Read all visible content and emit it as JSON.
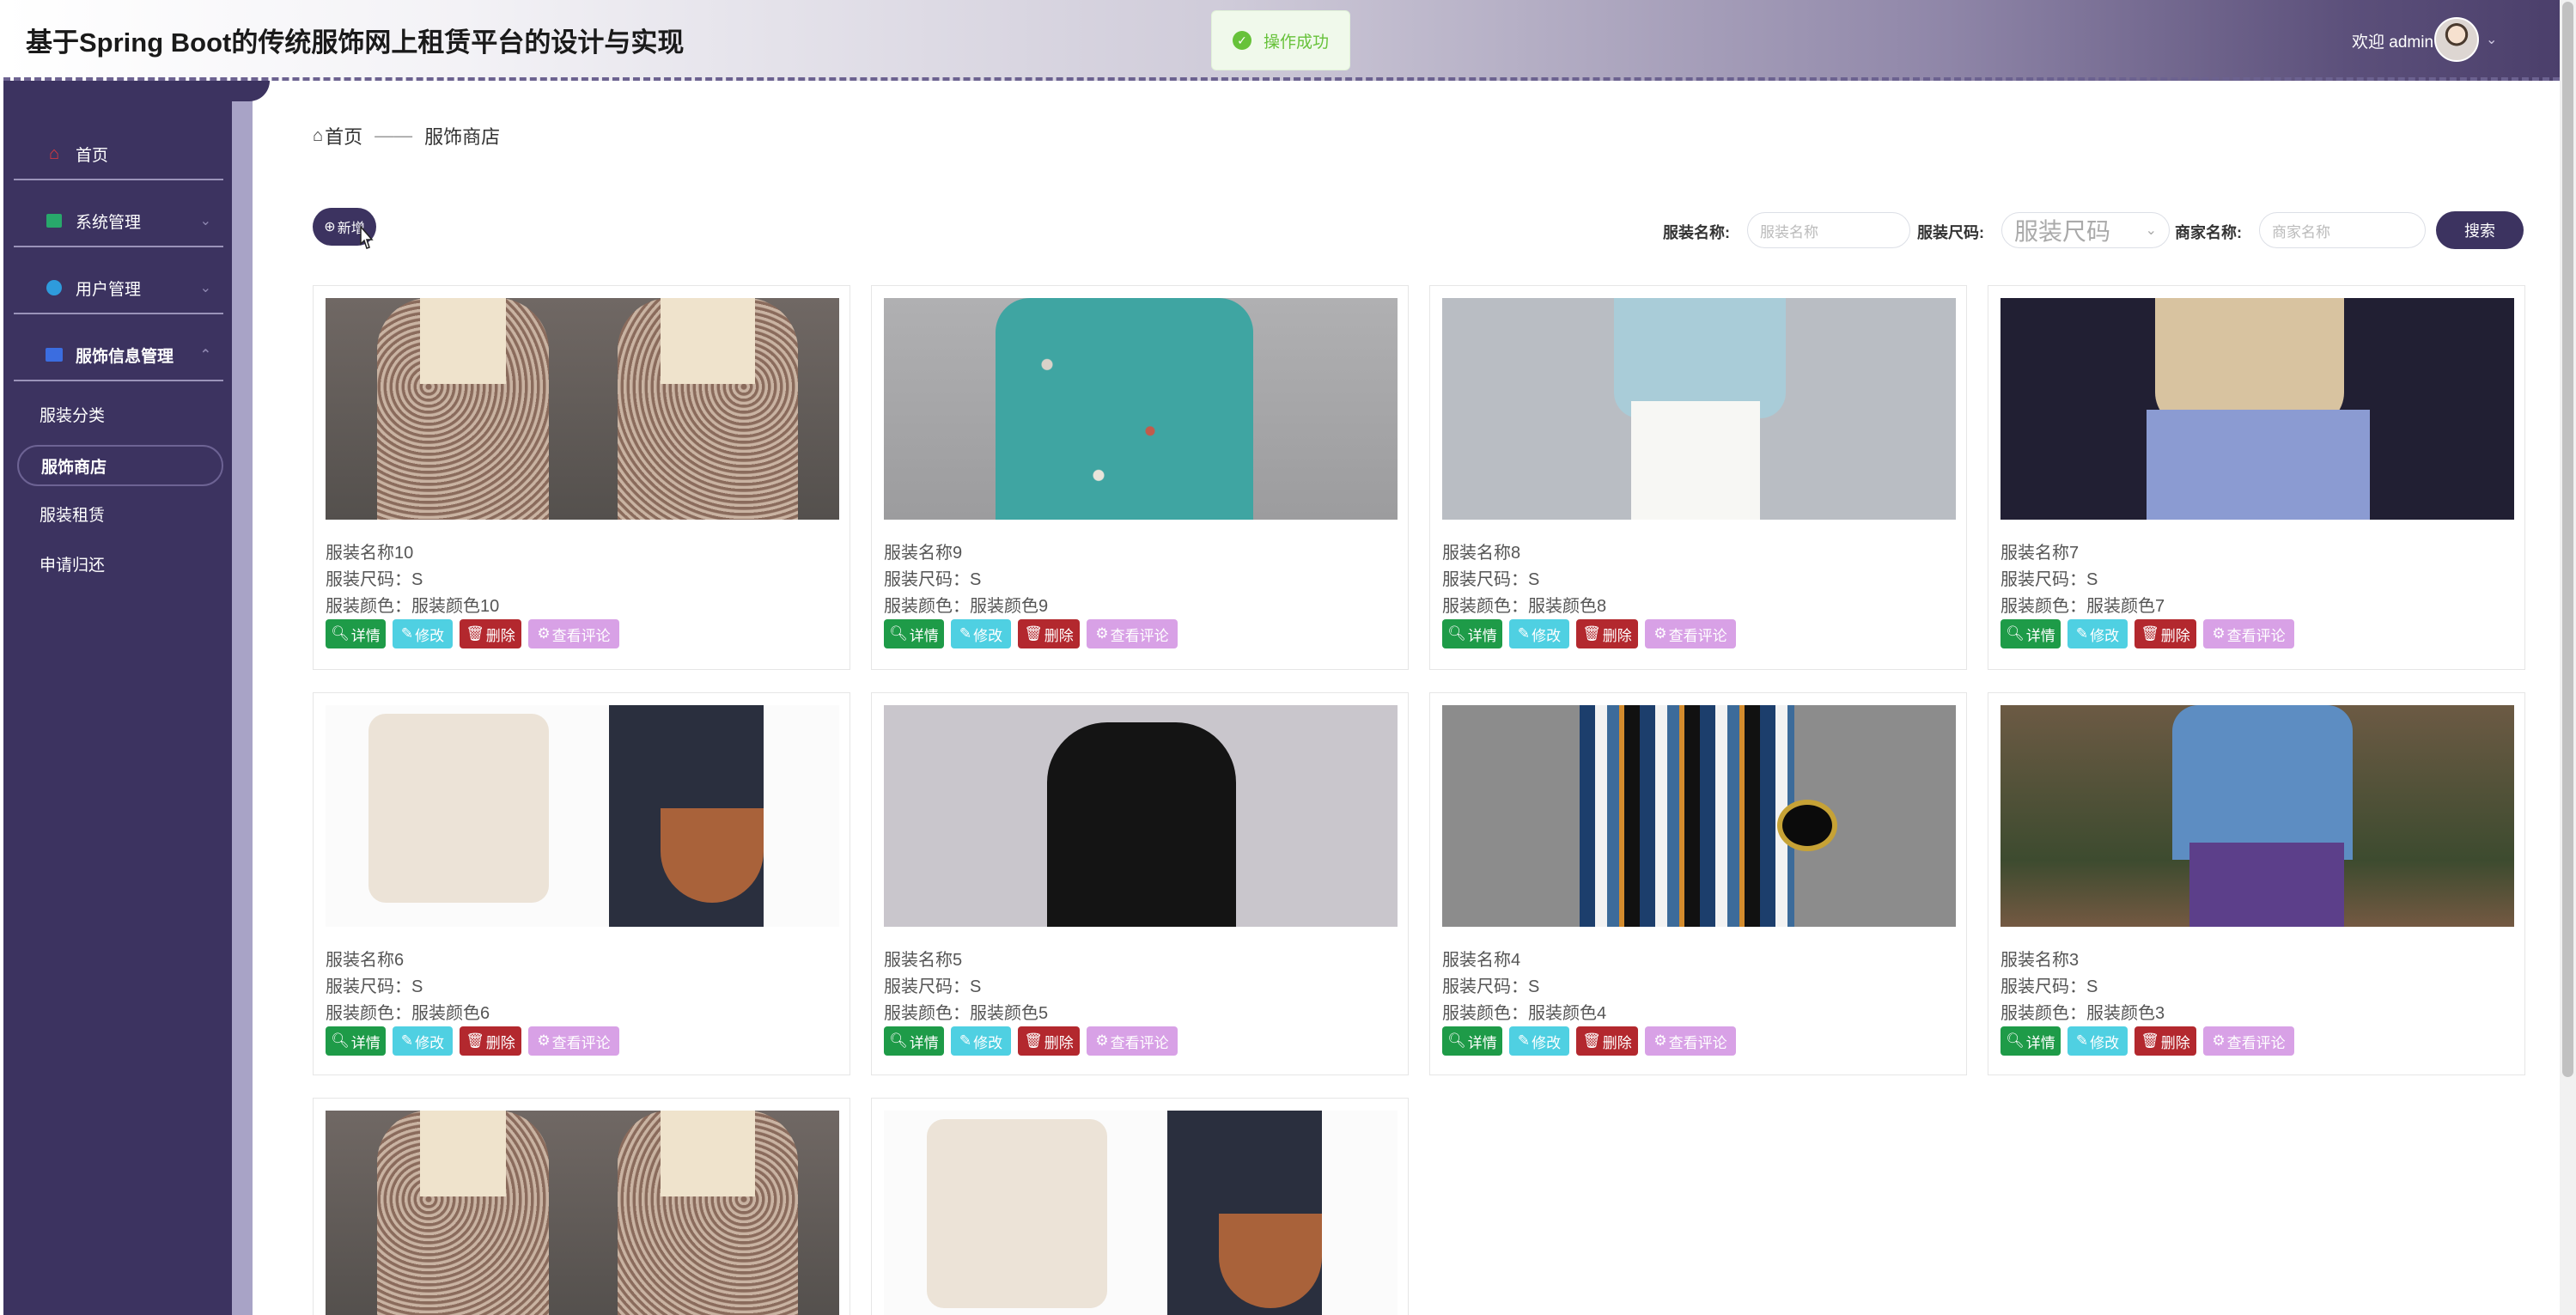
{
  "header": {
    "title": "基于Spring Boot的传统服饰网上租赁平台的设计与实现",
    "welcome": "欢迎 admin",
    "toast": "操作成功"
  },
  "sidebar": {
    "items": [
      {
        "label": "首页",
        "icon": "home-icon"
      },
      {
        "label": "系统管理",
        "icon": "system-icon"
      },
      {
        "label": "用户管理",
        "icon": "user-icon"
      },
      {
        "label": "服饰信息管理",
        "icon": "clothing-info-icon"
      }
    ],
    "sub_items": [
      "服装分类",
      "服饰商店",
      "服装租赁",
      "申请归还"
    ],
    "active_sub": "服饰商店"
  },
  "breadcrumb": {
    "home": "首页",
    "current": "服饰商店"
  },
  "toolbar": {
    "add_label": "新增",
    "search_label": "搜索"
  },
  "search": {
    "name_label": "服装名称:",
    "name_placeholder": "服装名称",
    "size_label": "服装尺码:",
    "size_placeholder": "服装尺码",
    "merchant_label": "商家名称:",
    "merchant_placeholder": "商家名称"
  },
  "actions": {
    "detail": "详情",
    "edit": "修改",
    "delete": "删除",
    "review": "查看评论"
  },
  "products": [
    {
      "name": "服装名称10",
      "size": "服装尺码：S",
      "color": "服装颜色：服装颜色10",
      "image": "floral-dress"
    },
    {
      "name": "服装名称9",
      "size": "服装尺码：S",
      "color": "服装颜色：服装颜色9",
      "image": "teal-floral-dress"
    },
    {
      "name": "服装名称8",
      "size": "服装尺码：S",
      "color": "服装颜色：服装颜色8",
      "image": "blue-top-white-pants"
    },
    {
      "name": "服装名称7",
      "size": "服装尺码：S",
      "color": "服装颜色：服装颜色7",
      "image": "khaki-top-blue-skirt"
    },
    {
      "name": "服装名称6",
      "size": "服装尺码：S",
      "color": "服装颜色：服装颜色6",
      "image": "cardigan-jeans-bag"
    },
    {
      "name": "服装名称5",
      "size": "服装尺码：S",
      "color": "服装颜色：服装颜色5",
      "image": "black-knit-dress"
    },
    {
      "name": "服装名称4",
      "size": "服装尺码：S",
      "color": "服装颜色：服装颜色4",
      "image": "striped-dress"
    },
    {
      "name": "服装名称3",
      "size": "服装尺码：S",
      "color": "服装颜色：服装颜色3",
      "image": "blue-hanfu"
    },
    {
      "name": "",
      "size": "",
      "color": "",
      "image": "floral-dress"
    },
    {
      "name": "",
      "size": "",
      "color": "",
      "image": "cardigan-jeans-bag"
    }
  ],
  "colors": {
    "accent": "#3c3360",
    "detail": "#1e9b48",
    "edit": "#4fd0e2",
    "delete": "#b3282e",
    "review": "#d8a1e6",
    "success": "#67c23a"
  }
}
